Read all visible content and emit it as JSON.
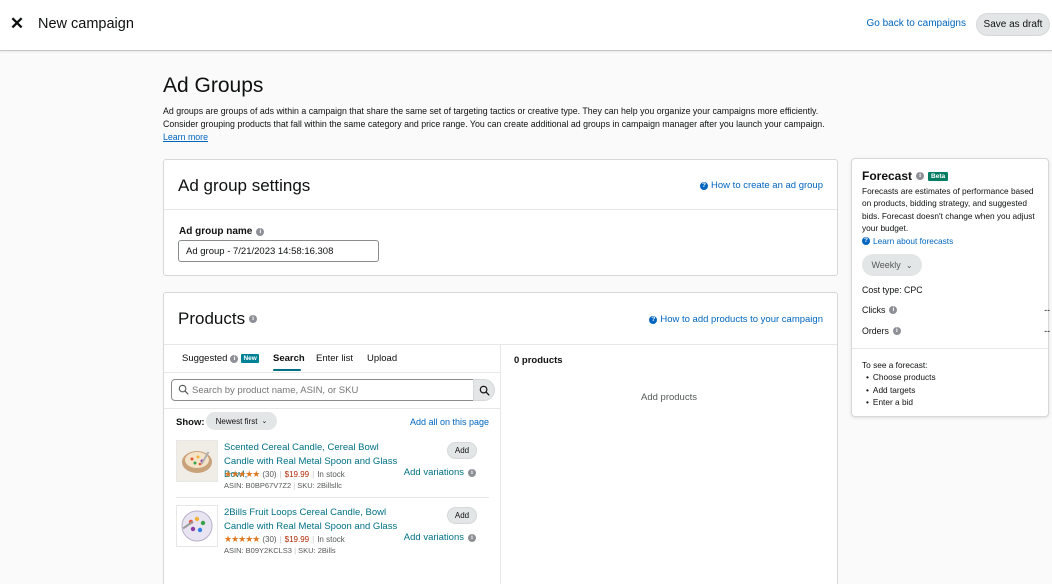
{
  "header": {
    "title": "New campaign",
    "back_link": "Go back to campaigns",
    "save_draft": "Save as draft"
  },
  "page": {
    "title": "Ad Groups",
    "intro": "Ad groups are groups of ads within a campaign that share the same set of targeting tactics or creative type. They can help you organize your campaigns more efficiently. Consider grouping products that fall within the same category and price range. You can create additional ad groups in campaign manager after you launch your campaign.",
    "learn_more": "Learn more"
  },
  "settings": {
    "title": "Ad group settings",
    "help_link": "How to create an ad group",
    "name_label": "Ad group name",
    "name_value": "Ad group - 7/21/2023 14:58:16.308"
  },
  "products": {
    "title": "Products",
    "help_link": "How to add products to your campaign",
    "tabs": [
      {
        "label": "Suggested",
        "badge": "New"
      },
      {
        "label": "Search"
      },
      {
        "label": "Enter list"
      },
      {
        "label": "Upload"
      }
    ],
    "search_placeholder": "Search by product name, ASIN, or SKU",
    "show_label": "Show:",
    "sort_value": "Newest first",
    "add_all": "Add all on this page",
    "items": [
      {
        "name": "Scented Cereal Candle, Cereal Bowl Candle with Real Metal Spoon and Glass Bowl,",
        "rating_count": "(30)",
        "price": "$19.99",
        "stock": "In stock",
        "asin": "ASIN: B0BP67V7Z2",
        "sku": "SKU: 2Billsllc",
        "add": "Add",
        "add_variations": "Add variations"
      },
      {
        "name": "2Bills Fruit Loops Cereal Candle, Bowl Candle with Real Metal Spoon and Glass",
        "rating_count": "(30)",
        "price": "$19.99",
        "stock": "In stock",
        "asin": "ASIN: B09Y2KCLS3",
        "sku": "SKU: 2Bills",
        "add": "Add",
        "add_variations": "Add variations"
      }
    ],
    "count": "0 products",
    "empty_text": "Add products"
  },
  "forecast": {
    "title": "Forecast",
    "badge": "Beta",
    "description": "Forecasts are estimates of performance based on products, bidding strategy, and suggested bids. Forecast doesn't change when you adjust your budget.",
    "learn_link": "Learn about forecasts",
    "period": "Weekly",
    "cost_type": "Cost type: CPC",
    "clicks_label": "Clicks",
    "clicks_value": "--",
    "orders_label": "Orders",
    "orders_value": "--",
    "instructions_title": "To see a forecast:",
    "instructions": [
      "Choose products",
      "Add targets",
      "Enter a bid"
    ]
  },
  "colors": {
    "link": "#0066c0",
    "teal": "#007185",
    "price": "#b12704",
    "star": "#de7921",
    "beta": "#067d62"
  }
}
